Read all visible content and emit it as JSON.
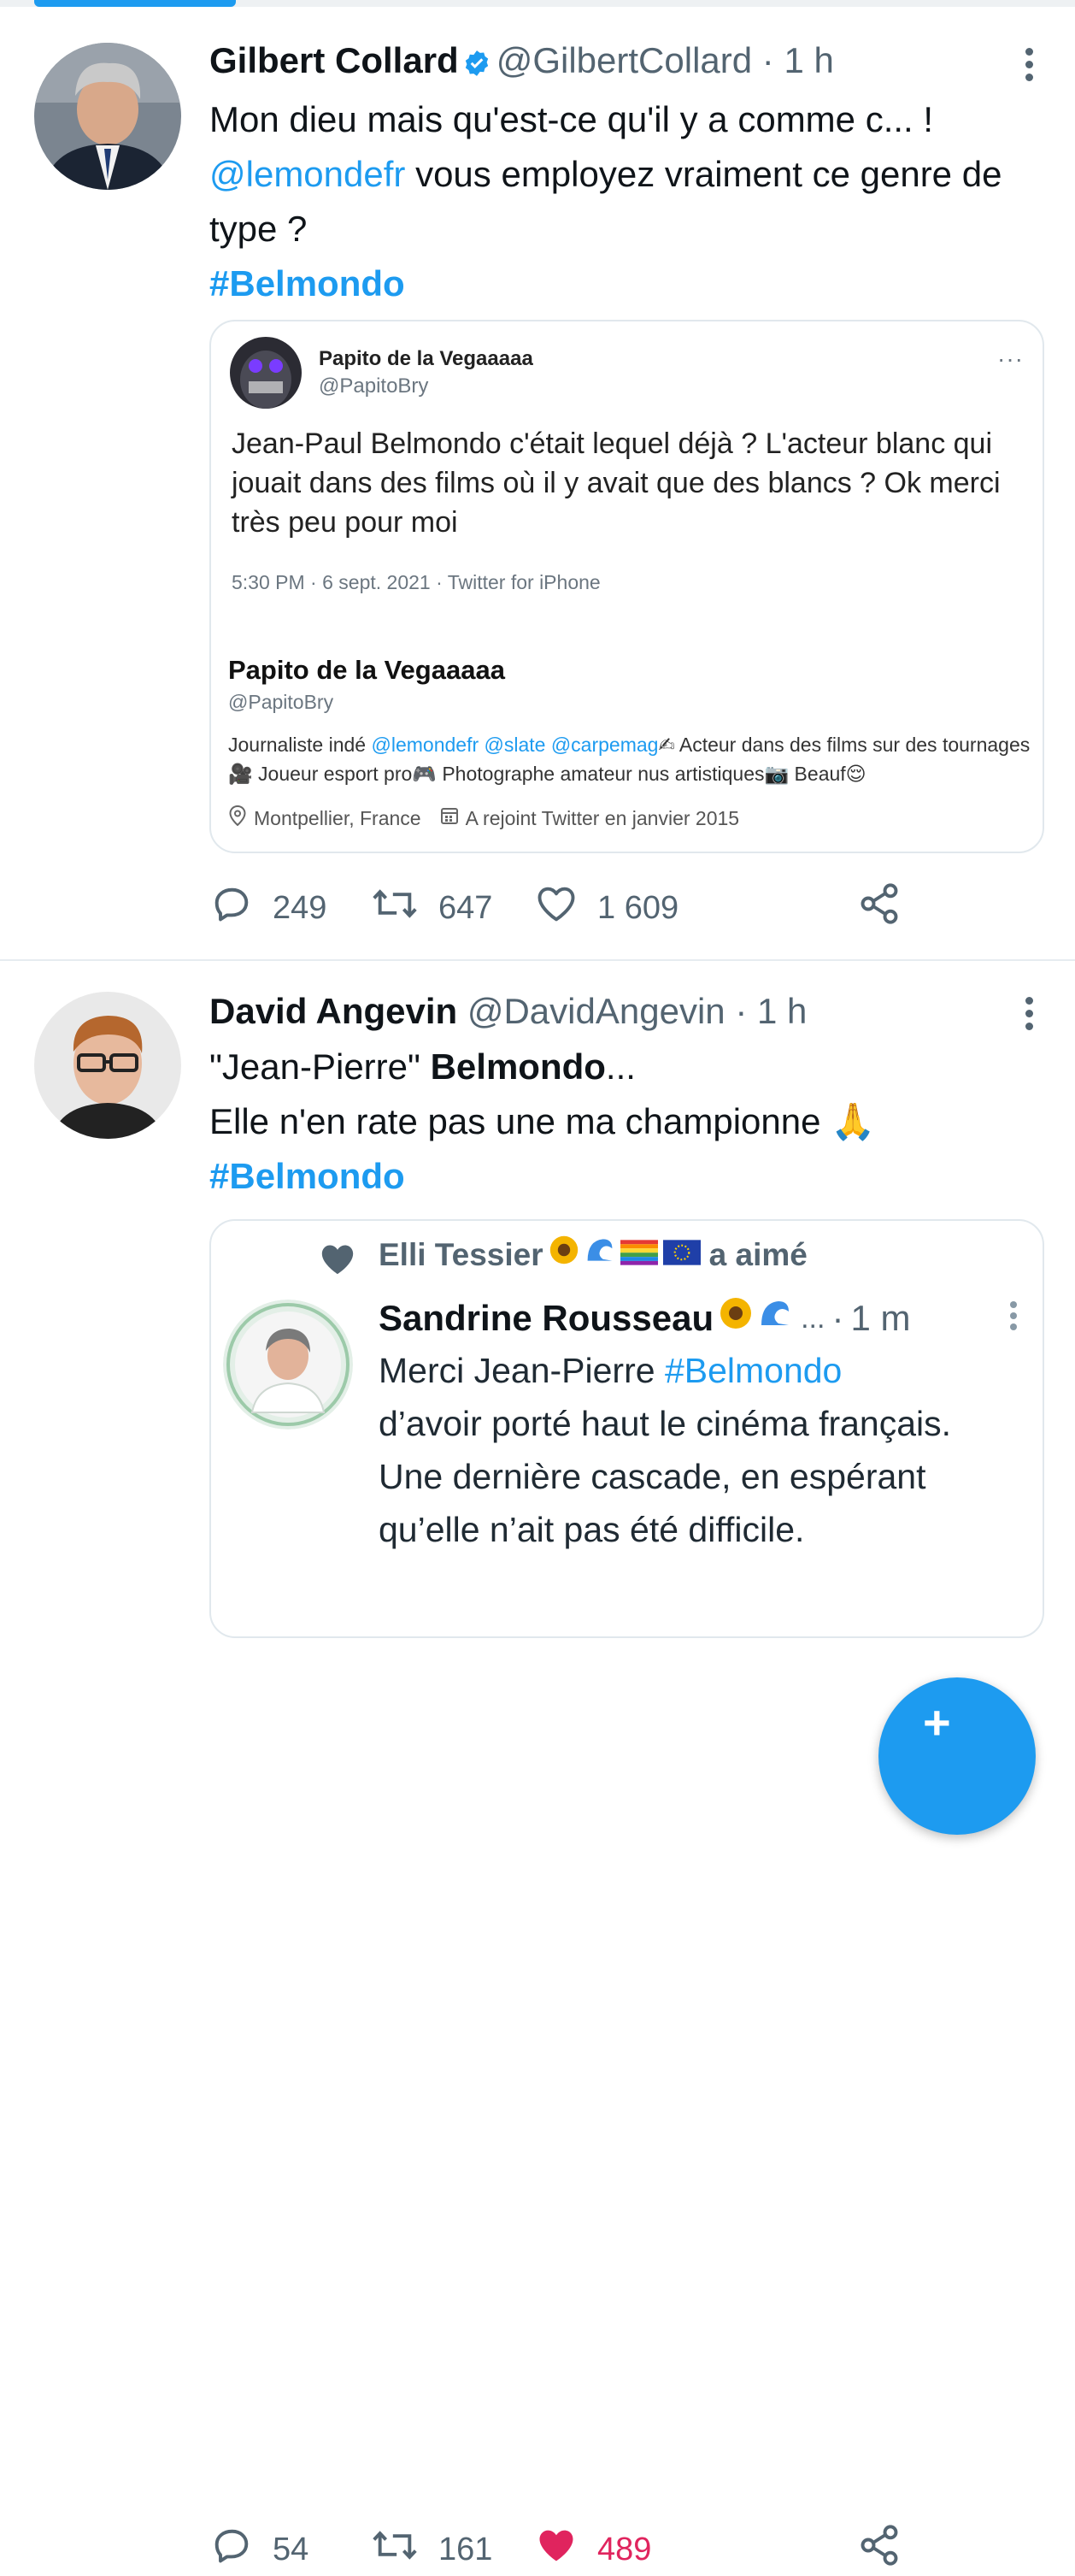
{
  "colors": {
    "accent": "#1d9bf0",
    "like": "#e0245e",
    "secondary_text": "#536471"
  },
  "tweets": [
    {
      "author": {
        "name": "Gilbert Collard",
        "verified": true,
        "handle": "@GilbertCollard",
        "separator": "·",
        "time": "1 h"
      },
      "text": {
        "line1": "Mon dieu mais qu'est-ce qu'il y a comme c... !",
        "mention": "@lemondefr",
        "after_mention": " vous employez vraiment ce genre de type ?",
        "hashtag": "#Belmondo"
      },
      "embed": {
        "author_name": "Papito de la Vegaaaaa",
        "author_handle": "@PapitoBry",
        "more": "···",
        "text": "Jean-Paul Belmondo c'était lequel déjà ? L'acteur blanc qui jouait dans des films où il y avait que des blancs ? Ok merci très peu pour moi",
        "meta": "5:30 PM · 6 sept. 2021 · Twitter for iPhone",
        "profile_name": "Papito de la Vegaaaaa",
        "profile_handle": "@PapitoBry",
        "bio_prefix": "Journaliste indé ",
        "bio_mentions": "@lemondefr @slate @carpemag",
        "bio_part2": " Acteur dans des films sur des tournages",
        "bio_part3": " Joueur esport pro",
        "bio_part4": " Photographe amateur nus artistiques",
        "bio_part5": " Beauf",
        "location": "Montpellier, France",
        "joined": "A rejoint Twitter en janvier 2015"
      },
      "actions": {
        "replies": "249",
        "retweets": "647",
        "likes": "1 609",
        "liked": false
      }
    },
    {
      "author": {
        "name": "David Angevin",
        "verified": false,
        "handle": "@DavidAngevin",
        "separator": "·",
        "time": "1 h"
      },
      "text": {
        "quoted": "\"Jean-Pierre\" ",
        "bold": "Belmondo",
        "ellipsis": "...",
        "line2": "Elle n'en rate pas une ma championne",
        "hashtag": "#Belmondo"
      },
      "embed": {
        "liker": "Elli Tessier",
        "liked_verb": "a aimé",
        "author_name": "Sandrine Rousseau",
        "truncation": "...",
        "separator": "·",
        "time": "1 m",
        "text_start": "Merci Jean-Pierre ",
        "hashtag": "#Belmondo",
        "text_rest": "d’avoir porté haut le cinéma français. Une dernière cascade, en espérant qu’elle n’ait pas été difficile."
      },
      "actions": {
        "replies": "54",
        "retweets": "161",
        "likes": "489",
        "liked": true
      }
    }
  ],
  "icons": {
    "reply": "speech-bubble-icon",
    "retweet": "retweet-icon",
    "like": "heart-icon",
    "share": "share-icon",
    "compose": "compose-plus-icon"
  }
}
